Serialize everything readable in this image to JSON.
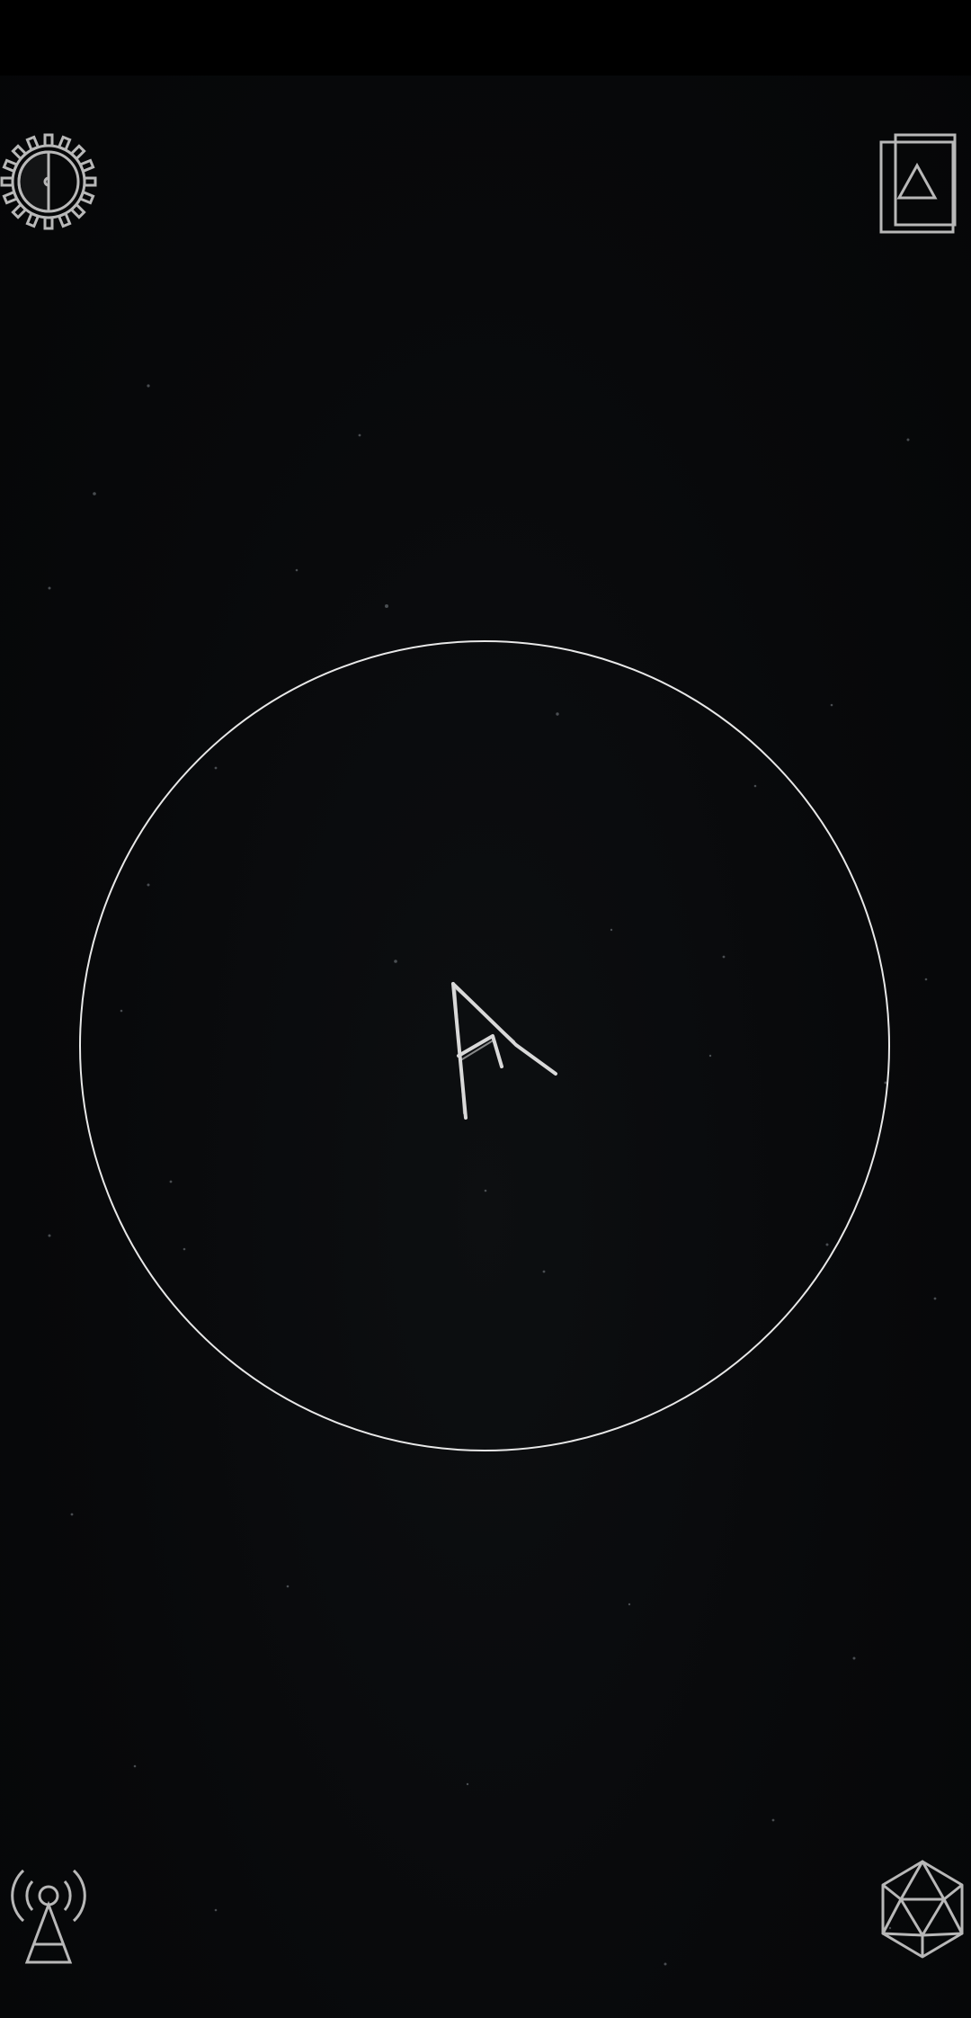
{
  "screen": {
    "background_color": "#050607",
    "status_bar_color": "#000000",
    "line_color": "#e8e8e8",
    "icon_color": "#b8b8b8"
  },
  "controls": {
    "top_left": {
      "icon": "gear-half-moon-icon",
      "meaning": "settings"
    },
    "top_right": {
      "icon": "stacked-cards-triangle-icon",
      "meaning": "rune-deck"
    },
    "bottom_left": {
      "icon": "signal-tower-icon",
      "meaning": "broadcast"
    },
    "bottom_right": {
      "icon": "icosahedron-dice-icon",
      "meaning": "cast-rune"
    }
  },
  "casting_circle": {
    "rune": "ᚨ",
    "rune_icon": "ansuz-rune-icon"
  }
}
